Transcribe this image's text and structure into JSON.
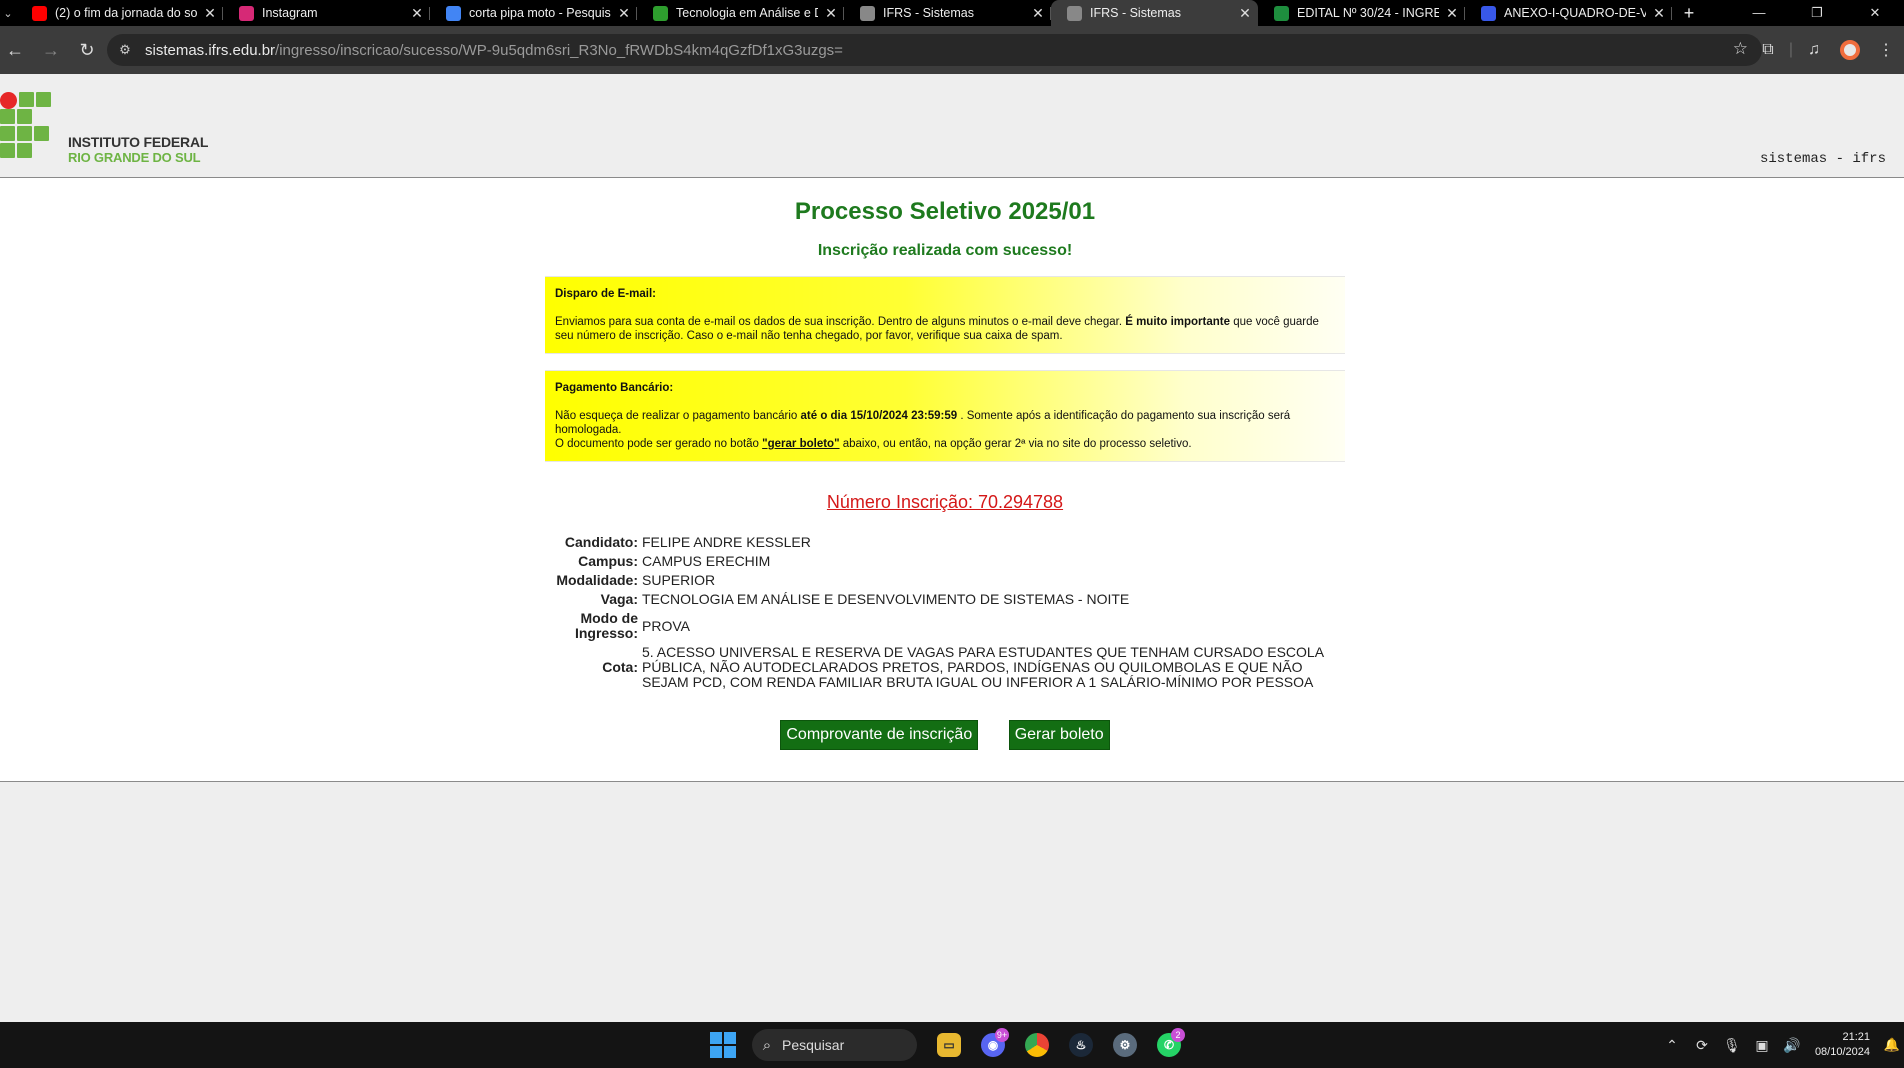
{
  "browser": {
    "tabs": [
      {
        "title": "(2) o fim da jornada do so",
        "favicon": "youtube-icon",
        "color": "#ff0000"
      },
      {
        "title": "Instagram",
        "favicon": "instagram-icon",
        "color": "#d62976"
      },
      {
        "title": "corta pipa moto - Pesquis",
        "favicon": "google-icon",
        "color": "#4285f4"
      },
      {
        "title": "Tecnologia em Análise e D",
        "favicon": "ifrs-icon",
        "color": "#2e9e2e"
      },
      {
        "title": "IFRS - Sistemas",
        "favicon": "globe-icon",
        "color": "#888888"
      },
      {
        "title": "IFRS - Sistemas",
        "favicon": "globe-icon",
        "color": "#888888",
        "active": true
      },
      {
        "title": "EDITAL Nº 30/24 - INGRE",
        "favicon": "sheets-icon",
        "color": "#1e8e3e"
      },
      {
        "title": "ANEXO-I-QUADRO-DE-V",
        "favicon": "wordpress-icon",
        "color": "#3858e9"
      }
    ],
    "url_host": "sistemas.ifrs.edu.br",
    "url_path": "/ingresso/inscricao/sucesso/WP-9u5qdm6sri_R3No_fRWDbS4km4qGzfDf1xG3uzgs="
  },
  "header": {
    "logo_line1": "INSTITUTO FEDERAL",
    "logo_line2": "RIO GRANDE DO SUL",
    "system_label": "sistemas - ifrs"
  },
  "main": {
    "title": "Processo Seletivo 2025/01",
    "subtitle": "Inscrição realizada com sucesso!",
    "email_notice": {
      "heading": "Disparo de E-mail:",
      "text_a": "Enviamos para sua conta de e-mail os dados de sua inscrição. Dentro de alguns minutos o e-mail deve chegar. ",
      "text_b": "É muito importante",
      "text_c": " que você guarde seu número de inscrição. Caso o e-mail não tenha chegado, por favor, verifique sua caixa de spam."
    },
    "payment_notice": {
      "heading": "Pagamento Bancário:",
      "text_a": "Não esqueça de realizar o pagamento bancário ",
      "text_b": "até o dia 15/10/2024 23:59:59",
      "text_c": " . Somente após a identificação do pagamento sua inscrição será homologada.",
      "text_d": "O documento pode ser gerado no botão ",
      "text_e": "\"gerar boleto\"",
      "text_f": " abaixo, ou então, na opção gerar 2ª via no site do processo seletivo."
    },
    "registration_number": "Número Inscrição: 70.294788",
    "fields": [
      {
        "label": "Candidato:",
        "value": "FELIPE ANDRE KESSLER"
      },
      {
        "label": "Campus:",
        "value": "CAMPUS ERECHIM"
      },
      {
        "label": "Modalidade:",
        "value": "SUPERIOR"
      },
      {
        "label": "Vaga:",
        "value": "TECNOLOGIA EM ANÁLISE E DESENVOLVIMENTO DE SISTEMAS - NOITE"
      },
      {
        "label": "Modo de Ingresso:",
        "value": "PROVA"
      },
      {
        "label": "Cota:",
        "value": "5. ACESSO UNIVERSAL E RESERVA DE VAGAS PARA ESTUDANTES QUE TENHAM CURSADO ESCOLA PÚBLICA, NÃO AUTODECLARADOS PRETOS, PARDOS, INDÍGENAS OU QUILOMBOLAS E QUE NÃO SEJAM PCD, COM RENDA FAMILIAR BRUTA IGUAL OU INFERIOR A 1 SALÁRIO-MÍNIMO POR PESSOA"
      }
    ],
    "buttons": {
      "receipt": "Comprovante de inscrição",
      "boleto": "Gerar boleto"
    }
  },
  "taskbar": {
    "search_label": "Pesquisar",
    "discord_badge": "9+",
    "whatsapp_badge": "2",
    "time": "21:21",
    "date": "08/10/2024"
  },
  "colors": {
    "title_green": "#1e7a1e",
    "notice_yellow": "#ffff00",
    "reg_number_red": "#d41818",
    "button_green": "#136e13",
    "logo_green": "#6eb444",
    "logo_red": "#e62727"
  }
}
